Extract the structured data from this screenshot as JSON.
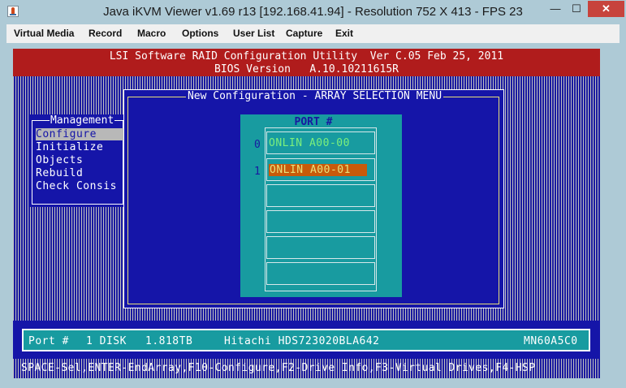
{
  "window": {
    "title": "Java iKVM Viewer v1.69 r13 [192.168.41.94]  - Resolution 752 X 413 - FPS 23",
    "minimize": "—",
    "maximize": "☐",
    "close": "✕",
    "app_icon": "java-icon"
  },
  "menubar": {
    "items": [
      "Virtual Media",
      "Record",
      "Macro",
      "Options",
      "User List",
      "Capture",
      "Exit"
    ]
  },
  "bios": {
    "header_line1": "LSI Software RAID Configuration Utility  Ver C.05 Feb 25, 2011",
    "header_line2": "BIOS Version   A.10.10211615R",
    "management": {
      "title": "Management",
      "items": [
        "Configure",
        "Initialize",
        "Objects",
        "Rebuild",
        "Check Consis"
      ],
      "selected_index": 0
    },
    "dialog": {
      "title": "New Configuration - ARRAY SELECTION MENU"
    },
    "ports": {
      "header": "PORT #",
      "rows": [
        {
          "number": "0",
          "status": "ONLIN A00-00"
        },
        {
          "number": "1",
          "status": "ONLIN A00-01"
        },
        {
          "number": "",
          "status": ""
        },
        {
          "number": "",
          "status": ""
        },
        {
          "number": "",
          "status": ""
        },
        {
          "number": "",
          "status": ""
        }
      ],
      "selected_index": 1
    },
    "status": {
      "port_label": "Port #",
      "disk": "1 DISK",
      "size": "1.818TB",
      "model": "Hitachi HDS723020BLA642",
      "serial": "MN60A5C0"
    },
    "help": "SPACE-Sel,ENTER-EndArray,F10-Configure,F2-Drive Info,F3-Virtual Drives,F4-HSP"
  },
  "colors": {
    "bios_blue": "#1515a8",
    "bios_red": "#b01c1c",
    "bios_teal": "#189ba0",
    "selection_orange": "#c85a0a",
    "online_green": "#7cf07c",
    "window_frame": "#aecad6",
    "close_red": "#c7433c"
  }
}
